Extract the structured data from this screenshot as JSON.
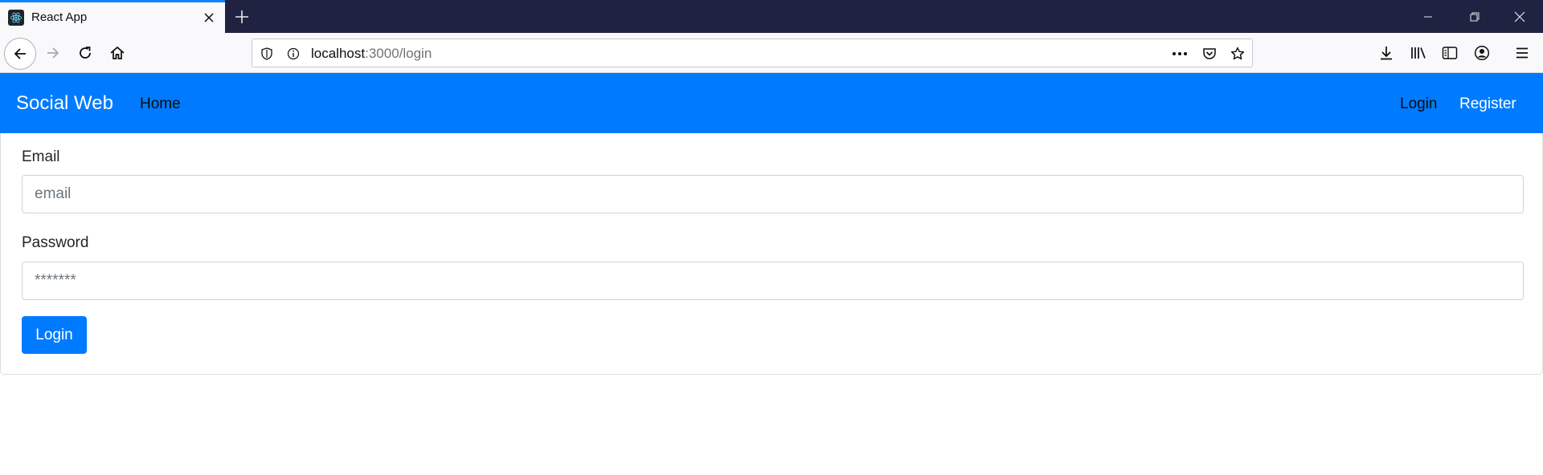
{
  "browser": {
    "tab": {
      "title": "React App",
      "favicon": "react-atom-icon"
    },
    "newtab_icon": "plus-icon",
    "window_controls": [
      "minimize-icon",
      "restore-icon",
      "close-icon"
    ],
    "toolbar": {
      "back_icon": "back-arrow-icon",
      "forward_icon": "forward-arrow-icon",
      "reload_icon": "reload-icon",
      "home_icon": "home-icon",
      "url_host": "localhost",
      "url_rest": ":3000/login",
      "page_actions": [
        "more-dots-icon",
        "pocket-icon",
        "bookmark-star-icon"
      ],
      "right_icons": [
        "download-icon",
        "library-icon",
        "sidebar-icon",
        "account-icon",
        "menu-hamburger-icon"
      ]
    }
  },
  "navbar": {
    "brand": "Social Web",
    "home": "Home",
    "login": "Login",
    "register": "Register",
    "bg_color": "#007bff"
  },
  "form": {
    "email_label": "Email",
    "email_placeholder": "email",
    "password_label": "Password",
    "password_placeholder": "*******",
    "submit_label": "Login"
  }
}
